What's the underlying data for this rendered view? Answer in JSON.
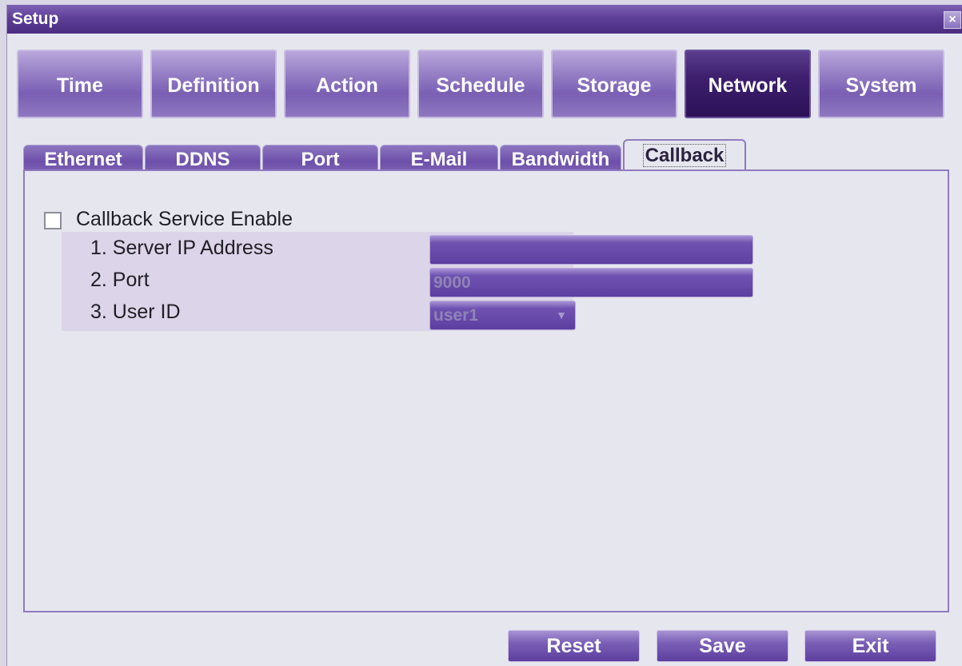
{
  "window": {
    "title": "Setup",
    "close_symbol": "×"
  },
  "main_tabs": [
    {
      "label": "Time",
      "active": false
    },
    {
      "label": "Definition",
      "active": false
    },
    {
      "label": "Action",
      "active": false
    },
    {
      "label": "Schedule",
      "active": false
    },
    {
      "label": "Storage",
      "active": false
    },
    {
      "label": "Network",
      "active": true
    },
    {
      "label": "System",
      "active": false
    }
  ],
  "sub_tabs": [
    {
      "label": "Ethernet",
      "active": false
    },
    {
      "label": "DDNS",
      "active": false
    },
    {
      "label": "Port",
      "active": false
    },
    {
      "label": "E-Mail",
      "active": false
    },
    {
      "label": "Bandwidth",
      "active": false
    },
    {
      "label": "Callback",
      "active": true
    }
  ],
  "callback": {
    "enable_label": "Callback Service Enable",
    "enable_checked": false,
    "fields": [
      {
        "label": "1. Server IP Address",
        "value": ""
      },
      {
        "label": "2. Port",
        "value": "9000"
      },
      {
        "label": "3. User ID",
        "value": "user1"
      }
    ]
  },
  "buttons": {
    "reset": "Reset",
    "save": "Save",
    "exit": "Exit"
  },
  "colors": {
    "accent": "#5e3f98",
    "active_tab": "#2d1158",
    "panel_border": "#8f7bbf"
  }
}
